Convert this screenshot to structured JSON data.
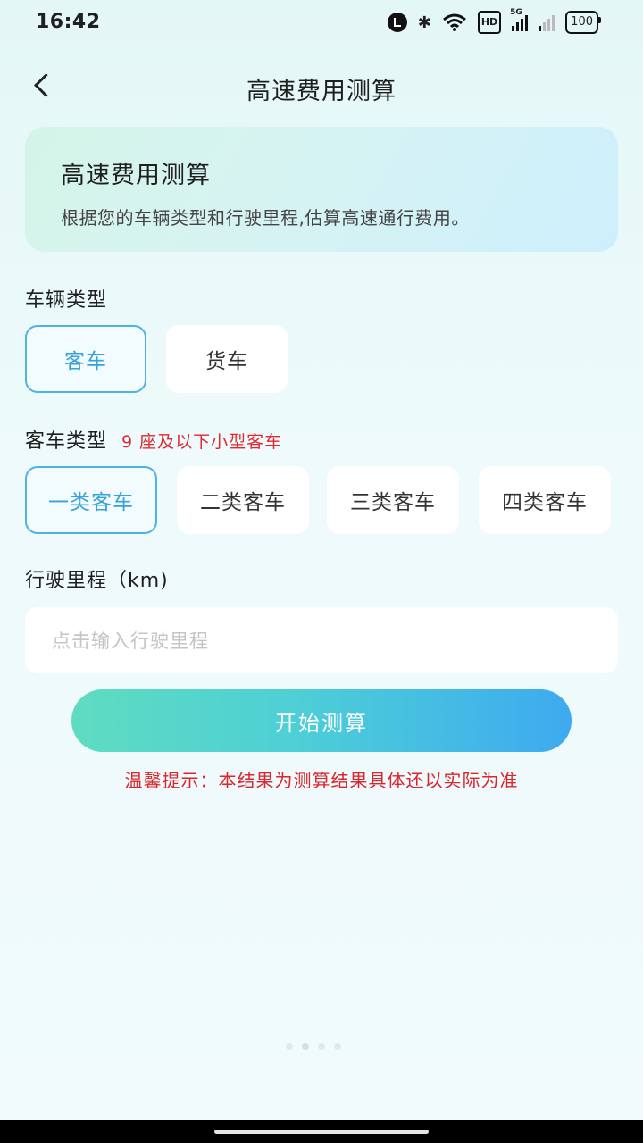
{
  "status_bar": {
    "time": "16:42",
    "icons": [
      "alarm-icon",
      "bluetooth-icon",
      "wifi-icon",
      "hd-icon",
      "signal-5g-icon",
      "signal-icon",
      "battery-icon"
    ],
    "hd_label": "HD",
    "network_label": "5G",
    "battery_level": "100"
  },
  "nav": {
    "back_icon": "chevron-left-icon",
    "title": "高速费用测算"
  },
  "intro": {
    "title": "高速费用测算",
    "description": "根据您的车辆类型和行驶里程,估算高速通行费用。"
  },
  "vehicle_type": {
    "label": "车辆类型",
    "options": [
      {
        "label": "客车",
        "selected": true
      },
      {
        "label": "货车",
        "selected": false
      }
    ]
  },
  "bus_type": {
    "label": "客车类型",
    "hint": "9 座及以下小型客车",
    "options": [
      {
        "label": "一类客车",
        "selected": true
      },
      {
        "label": "二类客车",
        "selected": false
      },
      {
        "label": "三类客车",
        "selected": false
      },
      {
        "label": "四类客车",
        "selected": false
      }
    ]
  },
  "mileage": {
    "label": "行驶里程（km)",
    "placeholder": "点击输入行驶里程",
    "value": ""
  },
  "start_button": "开始测算",
  "tip": "温馨提示：本结果为测算结果具体还以实际为准",
  "colors": {
    "accent": "#37a3d8",
    "hint_red": "#e0282e",
    "button_gradient_start": "#5fdcc0",
    "button_gradient_end": "#3eaaf0"
  }
}
